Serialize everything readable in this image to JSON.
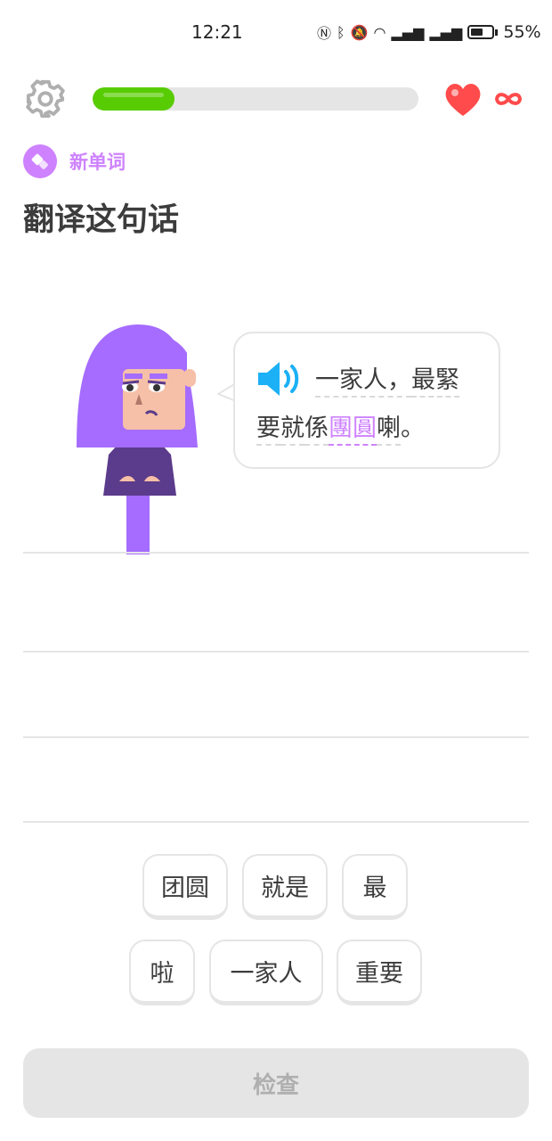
{
  "status_bar": {
    "time": "12:21",
    "icons": [
      "nfc-icon",
      "bluetooth-icon",
      "mute-icon",
      "wifi-icon",
      "signal-4g-icon",
      "signal-5g-icon"
    ],
    "battery": "55%"
  },
  "top_bar": {
    "progress": 0.25,
    "hearts": "∞",
    "accent_green": "#58cc02",
    "heart_color": "#ff4b4b"
  },
  "lesson": {
    "tag": "新单词",
    "title": "翻译这句话",
    "accent_purple": "#ce82ff"
  },
  "prompt": {
    "line1_words": [
      "一家人，",
      "最緊"
    ],
    "line2_words": [
      "要",
      "就",
      "係",
      "團圓",
      "喇",
      "。"
    ]
  },
  "word_bank": [
    "团圆",
    "就是",
    "最",
    "啦",
    "一家人",
    "重要"
  ],
  "check_button": "检查"
}
